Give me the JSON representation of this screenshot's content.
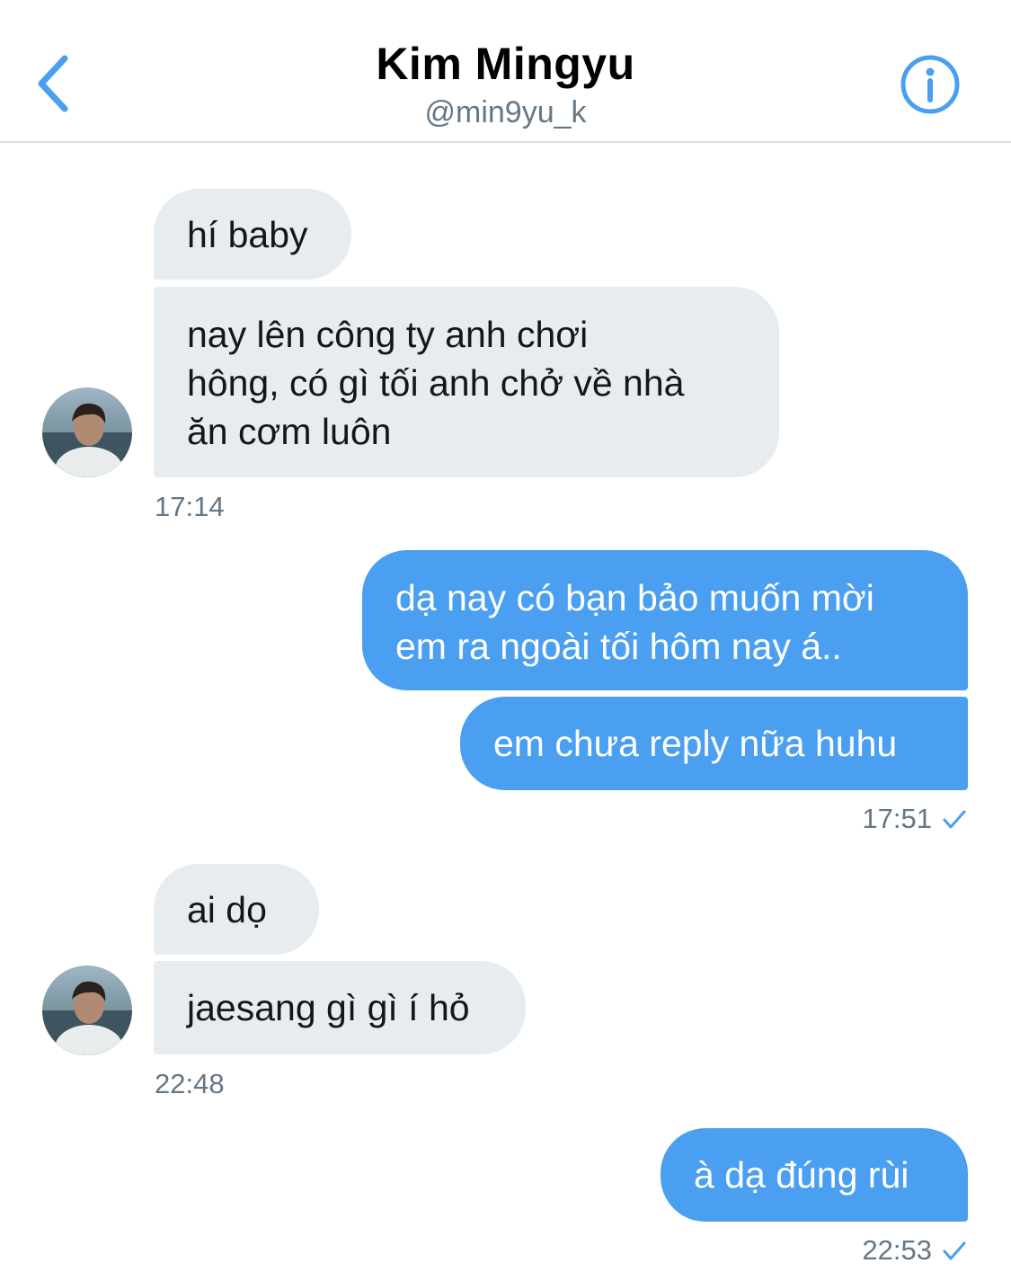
{
  "header": {
    "name": "Kim Mingyu",
    "handle": "@min9yu_k"
  },
  "messages": {
    "m1": "hí baby",
    "m2_lines": [
      "nay lên công ty anh chơi",
      "hông, có gì tối anh chở về nhà",
      "ăn cơm luôn"
    ],
    "t1": "17:14",
    "m3_lines": [
      "dạ nay có bạn bảo muốn mời",
      "em ra ngoài tối hôm nay á.."
    ],
    "m4": "em chưa reply nữa huhu",
    "t2": "17:51",
    "m5": "ai dọ",
    "m6": "jaesang gì gì í hỏ",
    "t3": "22:48",
    "m7": "à dạ đúng rùi",
    "t4": "22:53"
  },
  "colors": {
    "accent": "#4a9ff0",
    "incoming_bubble": "#e6ecf0",
    "timestamp": "#657786"
  },
  "icons": {
    "back": "chevron-left-icon",
    "info": "info-icon",
    "read": "checkmark-icon"
  }
}
